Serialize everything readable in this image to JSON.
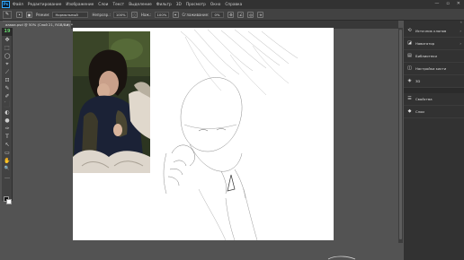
{
  "app": {
    "logo": "Ps"
  },
  "menu": [
    "Файл",
    "Редактирование",
    "Изображение",
    "Слои",
    "Текст",
    "Выделение",
    "Фильтр",
    "3D",
    "Просмотр",
    "Окно",
    "Справка"
  ],
  "window_controls": {
    "minimize": "—",
    "maximize": "▫",
    "close": "✕"
  },
  "options": {
    "mode_label": "Режим:",
    "mode_value": "Нормальный",
    "opacity_label": "Непрозр.:",
    "opacity_value": "100%",
    "flow_label": "Наж.:",
    "flow_value": "100%",
    "smoothing_label": "Сглаживание:",
    "smoothing_value": "0%"
  },
  "document": {
    "tab_title": "aaaaa.psd @ 50% (Слой 21, RGB/8#) *",
    "close": "×"
  },
  "tools": [
    "19",
    "✥",
    "⬚",
    "◯",
    "⌖",
    "⟋",
    "⊡",
    "✎",
    "✐",
    "⬛",
    "◐",
    "●",
    "✑",
    "T",
    "↖",
    "▭",
    "✋",
    "🔍",
    "…"
  ],
  "panels": {
    "collapse": "«",
    "group1": [
      {
        "icon": "⟲",
        "label": "Источник клонов"
      },
      {
        "icon": "◪",
        "label": "Навигатор"
      },
      {
        "icon": "▤",
        "label": "Библиотеки"
      },
      {
        "icon": "◫",
        "label": "Настройки кисти"
      },
      {
        "icon": "◈",
        "label": "3D"
      }
    ],
    "group2": [
      {
        "icon": "☰",
        "label": "Свойства"
      },
      {
        "icon": "◆",
        "label": "Слои"
      }
    ]
  },
  "colors": {
    "accent": "#31a8ff",
    "active_tool": "#64d16d"
  }
}
